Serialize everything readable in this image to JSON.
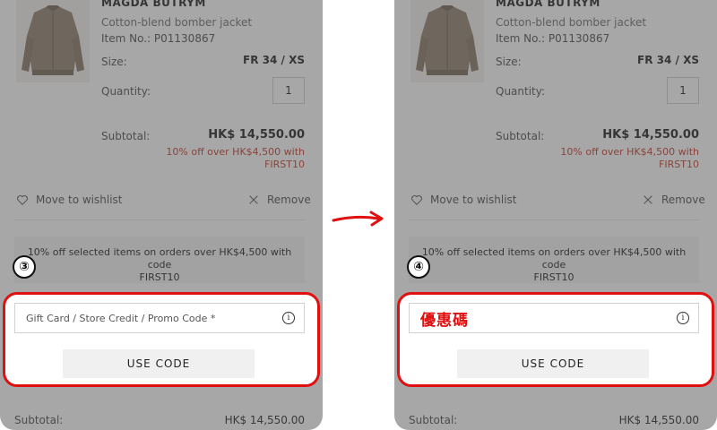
{
  "product": {
    "brand": "MAGDA BUTRYM",
    "name": "Cotton-blend bomber jacket",
    "item_no": "Item No.: P01130867",
    "size_label": "Size:",
    "size_value": "FR 34 / XS",
    "quantity_label": "Quantity:",
    "quantity_value": "1",
    "subtotal_label": "Subtotal:",
    "subtotal_value": "HK$ 14,550.00",
    "promo_line1": "10% off over HK$4,500 with",
    "promo_line2": "FIRST10"
  },
  "actions": {
    "wishlist_label": "Move to wishlist",
    "remove_label": "Remove"
  },
  "notice": {
    "line1": "10% off selected items on orders over HK$4,500 with code",
    "line2": "FIRST10"
  },
  "promo_field": {
    "placeholder": "Gift Card / Store Credit / Promo Code *",
    "annotation": "優惠碼",
    "info_glyph": "i"
  },
  "use_code_label": "USE CODE",
  "bottom": {
    "subtotal_label": "Subtotal:",
    "subtotal_value": "HK$ 14,550.00"
  },
  "steps": {
    "left": "③",
    "right": "④"
  },
  "colors": {
    "highlight": "#e01010",
    "promo_text": "#c0392b",
    "overlay": "rgba(80,80,80,0.5)"
  },
  "icons": [
    "heart-icon",
    "close-icon",
    "info-icon",
    "arrow-right-icon",
    "product-thumbnail"
  ]
}
